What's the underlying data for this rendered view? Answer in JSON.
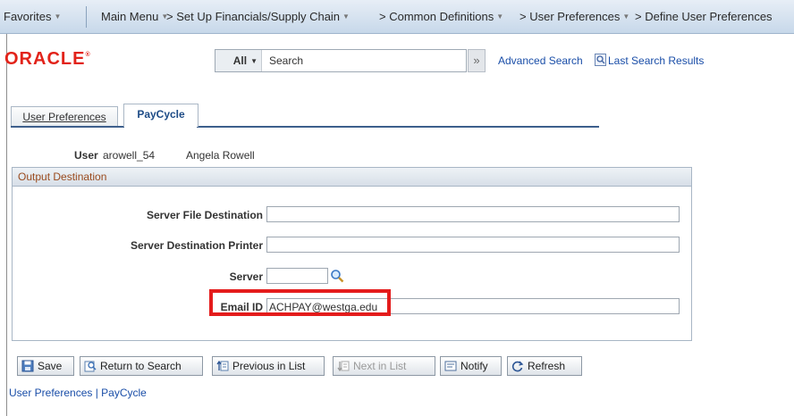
{
  "nav": {
    "favorites": "Favorites",
    "main_menu": "Main Menu",
    "path": [
      "Set Up Financials/Supply Chain",
      "Common Definitions",
      "User Preferences",
      "Define User Preferences"
    ]
  },
  "branding": {
    "logo": "ORACLE"
  },
  "search": {
    "category": "All",
    "placeholder": "Search",
    "advanced_label": "Advanced Search",
    "last_results_label": "Last Search Results"
  },
  "tabs": [
    {
      "label": "User Preferences",
      "active": false
    },
    {
      "label": "PayCycle",
      "active": true
    }
  ],
  "user": {
    "label": "User",
    "id": "arowell_54",
    "name": "Angela Rowell"
  },
  "group": {
    "title": "Output Destination",
    "fields": {
      "server_file_destination": {
        "label": "Server File Destination",
        "value": ""
      },
      "server_destination_printer": {
        "label": "Server Destination Printer",
        "value": ""
      },
      "server": {
        "label": "Server",
        "value": ""
      },
      "email_id": {
        "label": "Email ID",
        "value": "ACHPAY@westga.edu"
      }
    }
  },
  "toolbar": {
    "save": "Save",
    "return_to_search": "Return to Search",
    "previous_in_list": "Previous in List",
    "next_in_list": "Next in List",
    "notify": "Notify",
    "refresh": "Refresh"
  },
  "breadcrumbs": {
    "text": "User Preferences | PayCycle"
  },
  "colors": {
    "highlight": "#e41c1c",
    "link": "#1a4ea8",
    "brand": "#e2231a",
    "group_title": "#9a4b1e"
  }
}
